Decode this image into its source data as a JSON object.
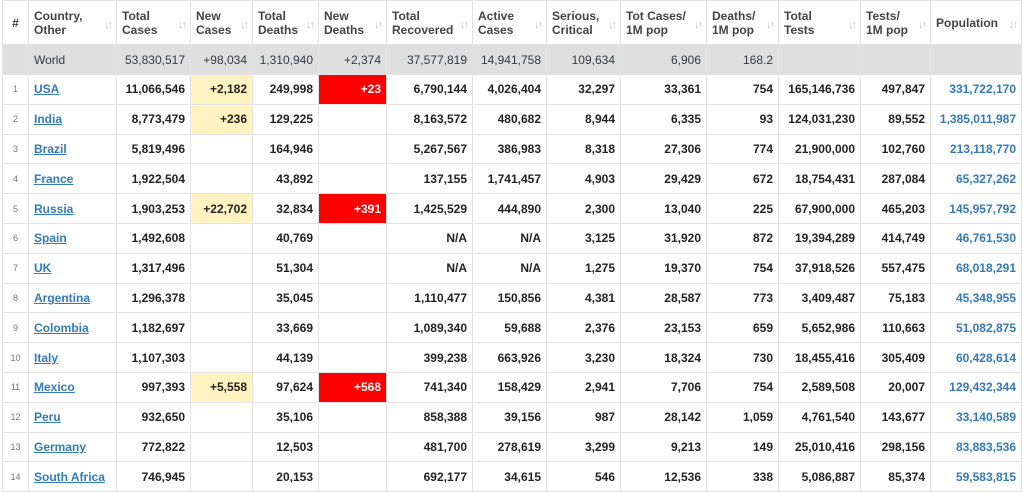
{
  "headers": {
    "rank": "#",
    "country": [
      "Country,",
      "Other"
    ],
    "total_cases": [
      "Total",
      "Cases"
    ],
    "new_cases": [
      "New",
      "Cases"
    ],
    "total_deaths": [
      "Total",
      "Deaths"
    ],
    "new_deaths": [
      "New",
      "Deaths"
    ],
    "total_recovered": [
      "Total",
      "Recovered"
    ],
    "active_cases": [
      "Active",
      "Cases"
    ],
    "serious_critical": [
      "Serious,",
      "Critical"
    ],
    "cases_per_1m": [
      "Tot Cases/",
      "1M pop"
    ],
    "deaths_per_1m": [
      "Deaths/",
      "1M pop"
    ],
    "total_tests": [
      "Total",
      "Tests"
    ],
    "tests_per_1m": [
      "Tests/",
      "1M pop"
    ],
    "population": [
      "Population"
    ]
  },
  "sort_glyph": "↓↑",
  "sort_glyph_active": "↓↑",
  "colors": {
    "new_cases_highlight": "#fff3c1",
    "new_deaths_highlight": "#ff0000",
    "world_row": "#dfdfdf",
    "link": "#337ab7"
  },
  "world": {
    "country": "World",
    "total_cases": "53,830,517",
    "new_cases": "+98,034",
    "total_deaths": "1,310,940",
    "new_deaths": "+2,374",
    "total_recovered": "37,577,819",
    "active_cases": "14,941,758",
    "serious_critical": "109,634",
    "cases_per_1m": "6,906",
    "deaths_per_1m": "168.2",
    "total_tests": "",
    "tests_per_1m": "",
    "population": ""
  },
  "rows": [
    {
      "rank": "1",
      "country": "USA",
      "total_cases": "11,066,546",
      "new_cases": "+2,182",
      "total_deaths": "249,998",
      "new_deaths": "+23",
      "total_recovered": "6,790,144",
      "active_cases": "4,026,404",
      "serious_critical": "32,297",
      "cases_per_1m": "33,361",
      "deaths_per_1m": "754",
      "total_tests": "165,146,736",
      "tests_per_1m": "497,847",
      "population": "331,722,170"
    },
    {
      "rank": "2",
      "country": "India",
      "total_cases": "8,773,479",
      "new_cases": "+236",
      "total_deaths": "129,225",
      "new_deaths": "",
      "total_recovered": "8,163,572",
      "active_cases": "480,682",
      "serious_critical": "8,944",
      "cases_per_1m": "6,335",
      "deaths_per_1m": "93",
      "total_tests": "124,031,230",
      "tests_per_1m": "89,552",
      "population": "1,385,011,987"
    },
    {
      "rank": "3",
      "country": "Brazil",
      "total_cases": "5,819,496",
      "new_cases": "",
      "total_deaths": "164,946",
      "new_deaths": "",
      "total_recovered": "5,267,567",
      "active_cases": "386,983",
      "serious_critical": "8,318",
      "cases_per_1m": "27,306",
      "deaths_per_1m": "774",
      "total_tests": "21,900,000",
      "tests_per_1m": "102,760",
      "population": "213,118,770"
    },
    {
      "rank": "4",
      "country": "France",
      "total_cases": "1,922,504",
      "new_cases": "",
      "total_deaths": "43,892",
      "new_deaths": "",
      "total_recovered": "137,155",
      "active_cases": "1,741,457",
      "serious_critical": "4,903",
      "cases_per_1m": "29,429",
      "deaths_per_1m": "672",
      "total_tests": "18,754,431",
      "tests_per_1m": "287,084",
      "population": "65,327,262"
    },
    {
      "rank": "5",
      "country": "Russia",
      "total_cases": "1,903,253",
      "new_cases": "+22,702",
      "total_deaths": "32,834",
      "new_deaths": "+391",
      "total_recovered": "1,425,529",
      "active_cases": "444,890",
      "serious_critical": "2,300",
      "cases_per_1m": "13,040",
      "deaths_per_1m": "225",
      "total_tests": "67,900,000",
      "tests_per_1m": "465,203",
      "population": "145,957,792"
    },
    {
      "rank": "6",
      "country": "Spain",
      "total_cases": "1,492,608",
      "new_cases": "",
      "total_deaths": "40,769",
      "new_deaths": "",
      "total_recovered": "N/A",
      "active_cases": "N/A",
      "serious_critical": "3,125",
      "cases_per_1m": "31,920",
      "deaths_per_1m": "872",
      "total_tests": "19,394,289",
      "tests_per_1m": "414,749",
      "population": "46,761,530"
    },
    {
      "rank": "7",
      "country": "UK",
      "total_cases": "1,317,496",
      "new_cases": "",
      "total_deaths": "51,304",
      "new_deaths": "",
      "total_recovered": "N/A",
      "active_cases": "N/A",
      "serious_critical": "1,275",
      "cases_per_1m": "19,370",
      "deaths_per_1m": "754",
      "total_tests": "37,918,526",
      "tests_per_1m": "557,475",
      "population": "68,018,291"
    },
    {
      "rank": "8",
      "country": "Argentina",
      "total_cases": "1,296,378",
      "new_cases": "",
      "total_deaths": "35,045",
      "new_deaths": "",
      "total_recovered": "1,110,477",
      "active_cases": "150,856",
      "serious_critical": "4,381",
      "cases_per_1m": "28,587",
      "deaths_per_1m": "773",
      "total_tests": "3,409,487",
      "tests_per_1m": "75,183",
      "population": "45,348,955"
    },
    {
      "rank": "9",
      "country": "Colombia",
      "total_cases": "1,182,697",
      "new_cases": "",
      "total_deaths": "33,669",
      "new_deaths": "",
      "total_recovered": "1,089,340",
      "active_cases": "59,688",
      "serious_critical": "2,376",
      "cases_per_1m": "23,153",
      "deaths_per_1m": "659",
      "total_tests": "5,652,986",
      "tests_per_1m": "110,663",
      "population": "51,082,875"
    },
    {
      "rank": "10",
      "country": "Italy",
      "total_cases": "1,107,303",
      "new_cases": "",
      "total_deaths": "44,139",
      "new_deaths": "",
      "total_recovered": "399,238",
      "active_cases": "663,926",
      "serious_critical": "3,230",
      "cases_per_1m": "18,324",
      "deaths_per_1m": "730",
      "total_tests": "18,455,416",
      "tests_per_1m": "305,409",
      "population": "60,428,614"
    },
    {
      "rank": "11",
      "country": "Mexico",
      "total_cases": "997,393",
      "new_cases": "+5,558",
      "total_deaths": "97,624",
      "new_deaths": "+568",
      "total_recovered": "741,340",
      "active_cases": "158,429",
      "serious_critical": "2,941",
      "cases_per_1m": "7,706",
      "deaths_per_1m": "754",
      "total_tests": "2,589,508",
      "tests_per_1m": "20,007",
      "population": "129,432,344"
    },
    {
      "rank": "12",
      "country": "Peru",
      "total_cases": "932,650",
      "new_cases": "",
      "total_deaths": "35,106",
      "new_deaths": "",
      "total_recovered": "858,388",
      "active_cases": "39,156",
      "serious_critical": "987",
      "cases_per_1m": "28,142",
      "deaths_per_1m": "1,059",
      "total_tests": "4,761,540",
      "tests_per_1m": "143,677",
      "population": "33,140,589"
    },
    {
      "rank": "13",
      "country": "Germany",
      "total_cases": "772,822",
      "new_cases": "",
      "total_deaths": "12,503",
      "new_deaths": "",
      "total_recovered": "481,700",
      "active_cases": "278,619",
      "serious_critical": "3,299",
      "cases_per_1m": "9,213",
      "deaths_per_1m": "149",
      "total_tests": "25,010,416",
      "tests_per_1m": "298,156",
      "population": "83,883,536"
    },
    {
      "rank": "14",
      "country": "South Africa",
      "total_cases": "746,945",
      "new_cases": "",
      "total_deaths": "20,153",
      "new_deaths": "",
      "total_recovered": "692,177",
      "active_cases": "34,615",
      "serious_critical": "546",
      "cases_per_1m": "12,536",
      "deaths_per_1m": "338",
      "total_tests": "5,086,887",
      "tests_per_1m": "85,374",
      "population": "59,583,815"
    }
  ]
}
